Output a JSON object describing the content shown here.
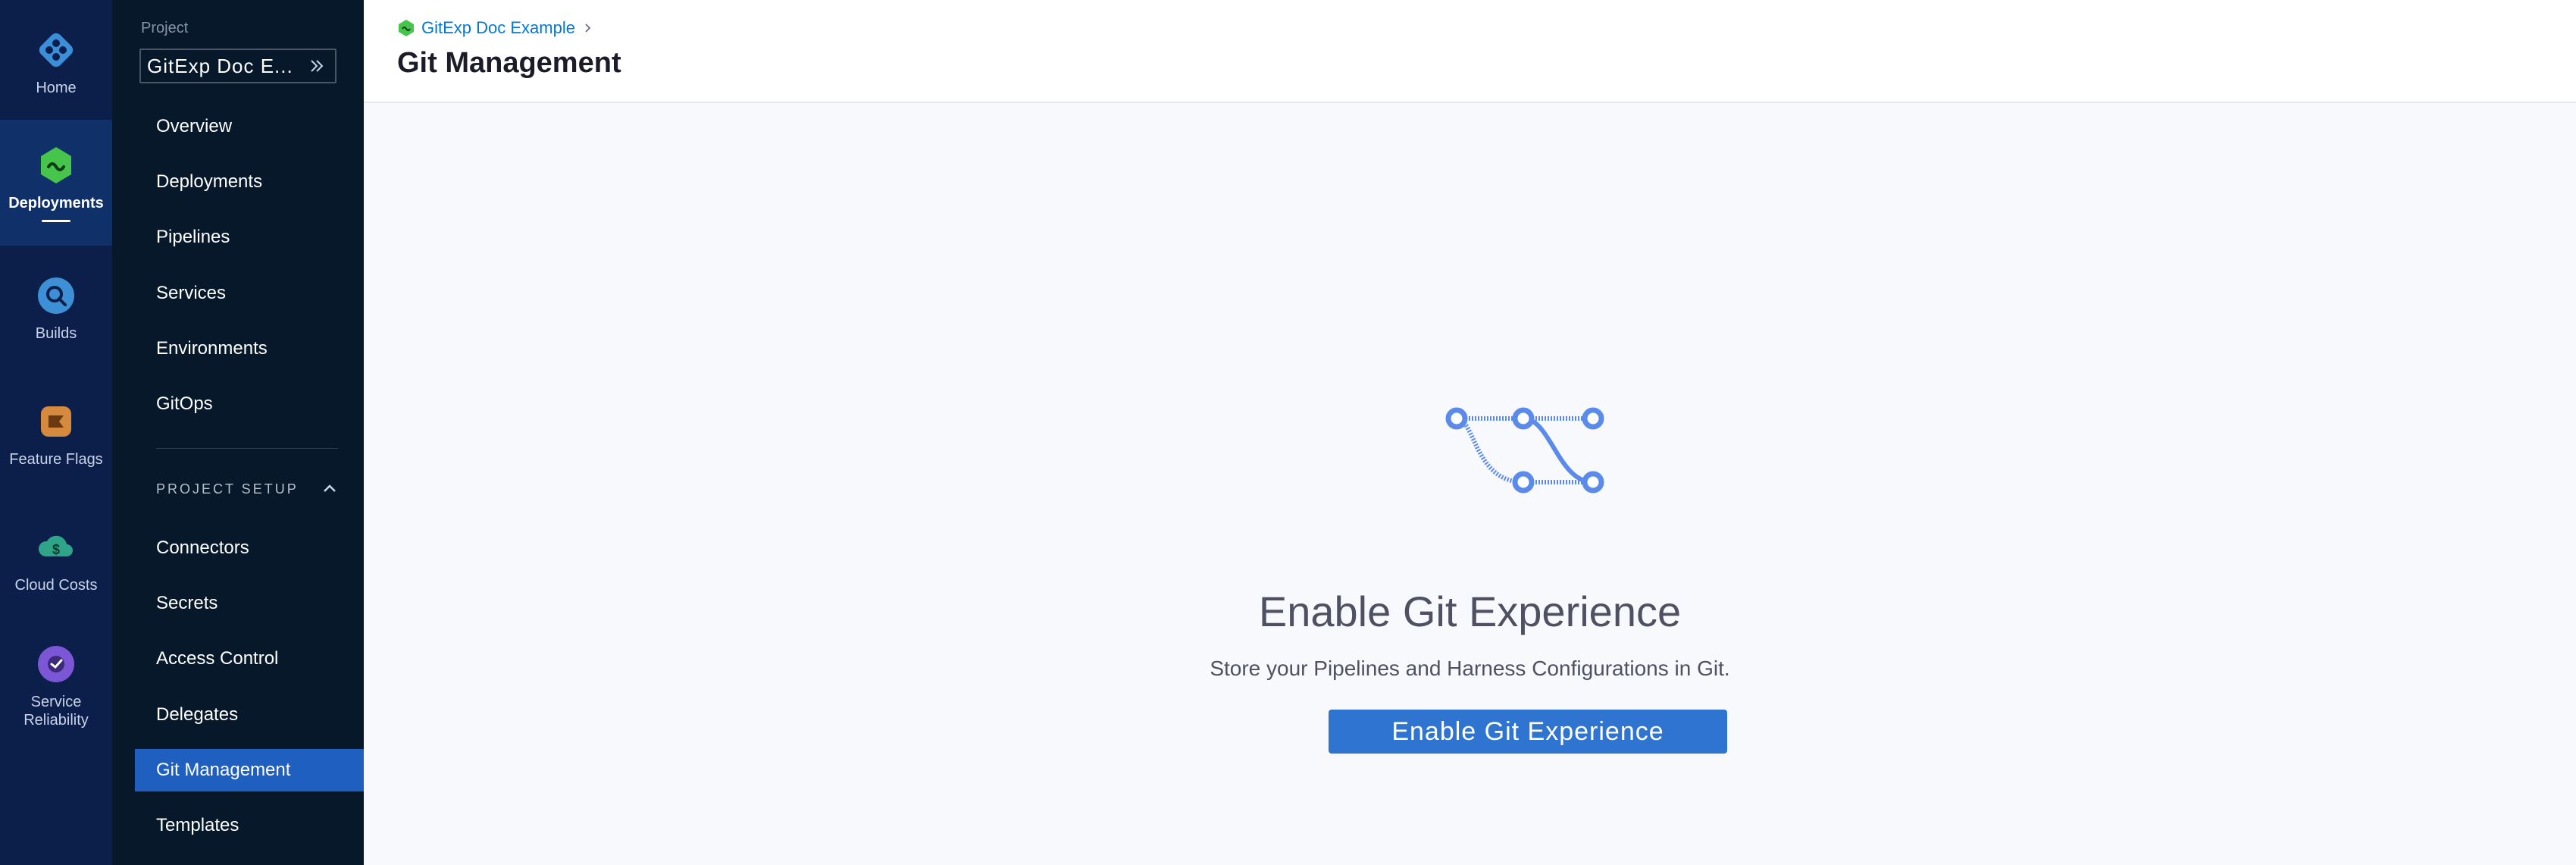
{
  "rail": {
    "items": [
      {
        "label": "Home",
        "icon": "harness-logo-icon"
      },
      {
        "label": "Deployments",
        "icon": "deployments-icon"
      },
      {
        "label": "Builds",
        "icon": "builds-icon"
      },
      {
        "label": "Feature Flags",
        "icon": "feature-flags-icon"
      },
      {
        "label": "Cloud Costs",
        "icon": "cloud-costs-icon"
      },
      {
        "label": "Service Reliability",
        "icon": "service-reliability-icon"
      }
    ],
    "active": "Deployments"
  },
  "project": {
    "label": "Project",
    "name": "GitExp Doc E..."
  },
  "nav": {
    "items": [
      "Overview",
      "Deployments",
      "Pipelines",
      "Services",
      "Environments",
      "GitOps"
    ],
    "section_title": "PROJECT SETUP",
    "setup_items": [
      "Connectors",
      "Secrets",
      "Access Control",
      "Delegates",
      "Git Management",
      "Templates"
    ],
    "active": "Git Management"
  },
  "header": {
    "breadcrumb": "GitExp Doc Example",
    "title": "Git Management"
  },
  "empty_state": {
    "title": "Enable Git Experience",
    "subtitle": "Store your Pipelines and Harness Configurations in Git.",
    "button_label": "Enable Git Experience"
  },
  "colors": {
    "rail_bg": "#0b1f4a",
    "nav_bg": "#07182b",
    "active_nav": "#1f5fbf",
    "primary_button": "#2f74d0",
    "link": "#0278d5"
  }
}
